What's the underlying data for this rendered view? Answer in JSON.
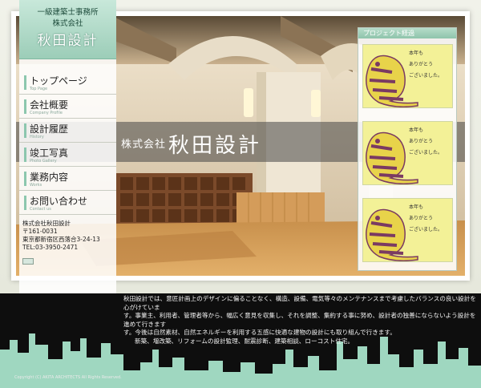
{
  "logo": {
    "line1": "一級建築士事務所",
    "line2": "株式会社",
    "line3": "秋田設計"
  },
  "hero": {
    "company": "株式会社",
    "name": "秋田設計"
  },
  "nav": {
    "items": [
      {
        "label": "トップページ",
        "sub": "Top Page"
      },
      {
        "label": "会社概要",
        "sub": "Company Profile"
      },
      {
        "label": "設計履歴",
        "sub": "History"
      },
      {
        "label": "竣工写真",
        "sub": "Photo Gallery"
      },
      {
        "label": "業務内容",
        "sub": "Works"
      },
      {
        "label": "お問い合わせ",
        "sub": "Contact us"
      }
    ]
  },
  "address": {
    "company": "株式会社秋田設計",
    "zip": "〒161-0031",
    "addr": "東京都新宿区西落合3-24-13",
    "tel": "TEL:03-3950-2471"
  },
  "project": {
    "title": "プロジェクト経過",
    "cards": [
      {
        "msg1": "本年も",
        "msg2": "ありがとう",
        "msg3": "ございました。"
      },
      {
        "msg1": "本年も",
        "msg2": "ありがとう",
        "msg3": "ございました。"
      },
      {
        "msg1": "本年も",
        "msg2": "ありがとう",
        "msg3": "ございました。"
      }
    ]
  },
  "description": {
    "line1": "秋田設計では、意匠計画上のデザインに偏ることなく、構造、設備、電気等々のメンテナンスまで考慮したバランスの良い設計を心がけていま",
    "line2": "す。事業主、利用者、管理者等から、幅広く意見を収集し、それを調整、集約する事に努め、設計者の独善にならないよう設計を進めて行きます",
    "line3": "す。今後は自然素材、自然エネルギーを利用する五感に快適な建物の設計にも取り組んで行きます。",
    "line4": "新築、増改築、リフォームの設計監理、耐震診断、建築相談、ローコスト住宅。"
  },
  "footer": {
    "copyright": "Copyright (C) AKITA ARCHITECTS All Rights Reserved."
  },
  "colors": {
    "accent": "#8cc7ae",
    "skyline": "#9fd7c0",
    "bottom": "#0e0e0e"
  }
}
